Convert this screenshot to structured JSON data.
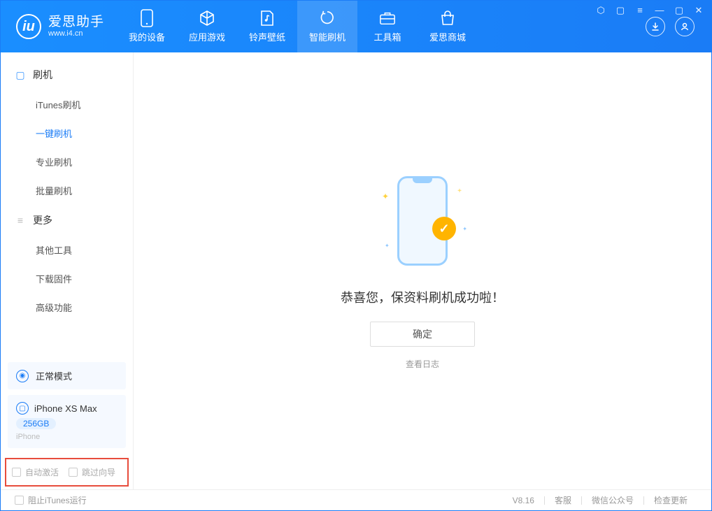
{
  "app": {
    "title": "爱思助手",
    "url": "www.i4.cn"
  },
  "header": {
    "tabs": [
      {
        "label": "我的设备"
      },
      {
        "label": "应用游戏"
      },
      {
        "label": "铃声壁纸"
      },
      {
        "label": "智能刷机"
      },
      {
        "label": "工具箱"
      },
      {
        "label": "爱思商城"
      }
    ]
  },
  "sidebar": {
    "section1_title": "刷机",
    "items1": [
      {
        "label": "iTunes刷机"
      },
      {
        "label": "一键刷机"
      },
      {
        "label": "专业刷机"
      },
      {
        "label": "批量刷机"
      }
    ],
    "section2_title": "更多",
    "items2": [
      {
        "label": "其他工具"
      },
      {
        "label": "下载固件"
      },
      {
        "label": "高级功能"
      }
    ],
    "mode": "正常模式",
    "device_name": "iPhone XS Max",
    "device_storage": "256GB",
    "device_type": "iPhone",
    "checkbox1": "自动激活",
    "checkbox2": "跳过向导"
  },
  "main": {
    "success_message": "恭喜您，保资料刷机成功啦！",
    "ok_button": "确定",
    "view_log": "查看日志"
  },
  "footer": {
    "prevent_itunes": "阻止iTunes运行",
    "version": "V8.16",
    "support": "客服",
    "wechat": "微信公众号",
    "update": "检查更新"
  }
}
